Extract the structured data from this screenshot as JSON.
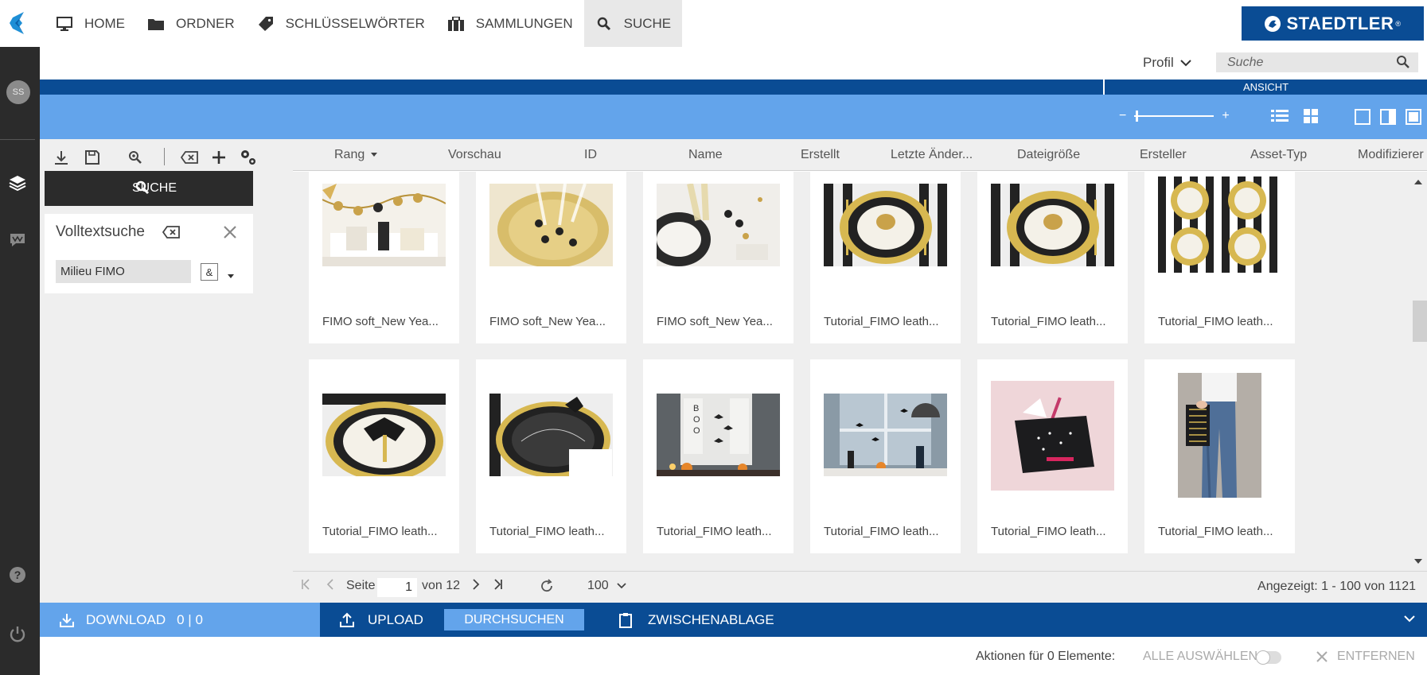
{
  "nav": {
    "items": [
      {
        "label": "HOME",
        "icon": "monitor-icon"
      },
      {
        "label": "ORDNER",
        "icon": "folder-icon"
      },
      {
        "label": "SCHLÜSSELWÖRTER",
        "icon": "tag-icon"
      },
      {
        "label": "SAMMLUNGEN",
        "icon": "briefcase-icon"
      },
      {
        "label": "SUCHE",
        "icon": "search-icon",
        "active": true
      }
    ],
    "brand": "STAEDTLER"
  },
  "rail": {
    "avatar_initials": "SS",
    "icons": [
      "layers-icon",
      "feedback-icon",
      "help-icon",
      "power-icon"
    ]
  },
  "header": {
    "profile_label": "Profil",
    "search_placeholder": "Suche",
    "ansicht_label": "ANSICHT",
    "zoom_minus": "−",
    "zoom_plus": "+"
  },
  "left_panel": {
    "toolbar_icons": [
      "download-icon",
      "save-icon",
      "search-settings-icon",
      "clear-icon",
      "add-icon",
      "settings-icon"
    ],
    "search_button_label": "SUCHE",
    "fulltext": {
      "title": "Volltextsuche",
      "value": "Milieu FIMO",
      "operator": "&"
    }
  },
  "columns": [
    "Rang",
    "Vorschau",
    "ID",
    "Name",
    "Erstellt",
    "Letzte Änder...",
    "Dateigröße",
    "Ersteller",
    "Asset-Typ",
    "Modifizierer"
  ],
  "assets": [
    {
      "caption": "FIMO soft_New Yea...",
      "thumb": "gold-party-garland"
    },
    {
      "caption": "FIMO soft_New Yea...",
      "thumb": "gold-plate-glasses"
    },
    {
      "caption": "FIMO soft_New Yea...",
      "thumb": "champagne-table"
    },
    {
      "caption": "Tutorial_FIMO leath...",
      "thumb": "gold-black-plate"
    },
    {
      "caption": "Tutorial_FIMO leath...",
      "thumb": "gold-black-plate-2"
    },
    {
      "caption": "Tutorial_FIMO leath...",
      "thumb": "striped-table-set"
    },
    {
      "caption": "Tutorial_FIMO leath...",
      "thumb": "bat-plate"
    },
    {
      "caption": "Tutorial_FIMO leath...",
      "thumb": "chalk-plate"
    },
    {
      "caption": "Tutorial_FIMO leath...",
      "thumb": "boo-door"
    },
    {
      "caption": "Tutorial_FIMO leath...",
      "thumb": "halloween-window"
    },
    {
      "caption": "Tutorial_FIMO leath...",
      "thumb": "black-clutch-pink"
    },
    {
      "caption": "Tutorial_FIMO leath...",
      "thumb": "woman-clutch"
    }
  ],
  "pager": {
    "page_label": "Seite",
    "page_value": "1",
    "of_label": "von 12",
    "per_page": "100",
    "summary": "Angezeigt: 1 - 100 von 1121"
  },
  "actions": {
    "download_label": "DOWNLOAD",
    "download_count": "0 | 0",
    "upload_label": "UPLOAD",
    "browse_label": "DURCHSUCHEN",
    "clipboard_label": "ZWISCHENABLAGE"
  },
  "footer": {
    "actions_label": "Aktionen für 0 Elemente:",
    "select_all_label": "ALLE AUSWÄHLEN",
    "remove_label": "ENTFERNEN"
  },
  "colors": {
    "dark_blue": "#0a4c94",
    "light_blue": "#63a4eb",
    "rail": "#2b2b2b"
  }
}
